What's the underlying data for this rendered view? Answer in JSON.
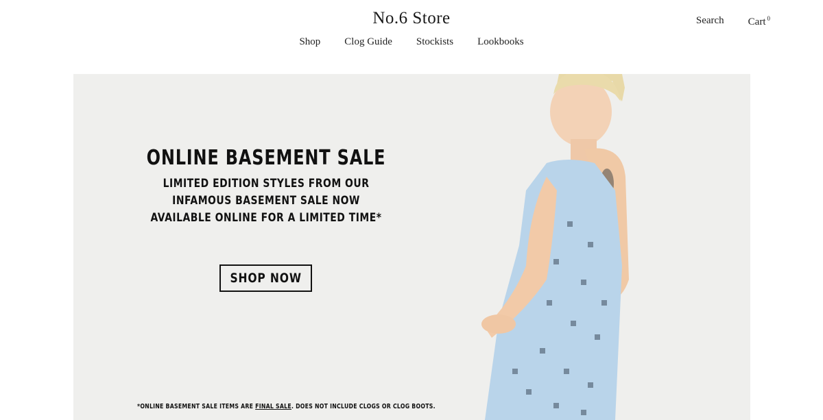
{
  "header": {
    "logo": "No.6 Store",
    "search_label": "Search",
    "cart_label": "Cart",
    "cart_count": "0"
  },
  "nav": {
    "items": [
      "Shop",
      "Clog Guide",
      "Stockists",
      "Lookbooks"
    ]
  },
  "hero": {
    "headline": "ONLINE BASEMENT SALE",
    "subtext_lines": [
      "LIMITED EDITION STYLES FROM OUR",
      "INFAMOUS BASEMENT SALE NOW",
      "AVAILABLE ONLINE FOR A LIMITED TIME*"
    ],
    "cta_label": "SHOP NOW",
    "disclaimer": {
      "before": "*ONLINE BASEMENT SALE ITEMS ARE ",
      "emphasis": "FINAL SALE",
      "after": ". DOES NOT INCLUDE CLOGS OR CLOG BOOTS."
    },
    "background_color": "#efefed",
    "dress_color": "#b9d4ea"
  }
}
